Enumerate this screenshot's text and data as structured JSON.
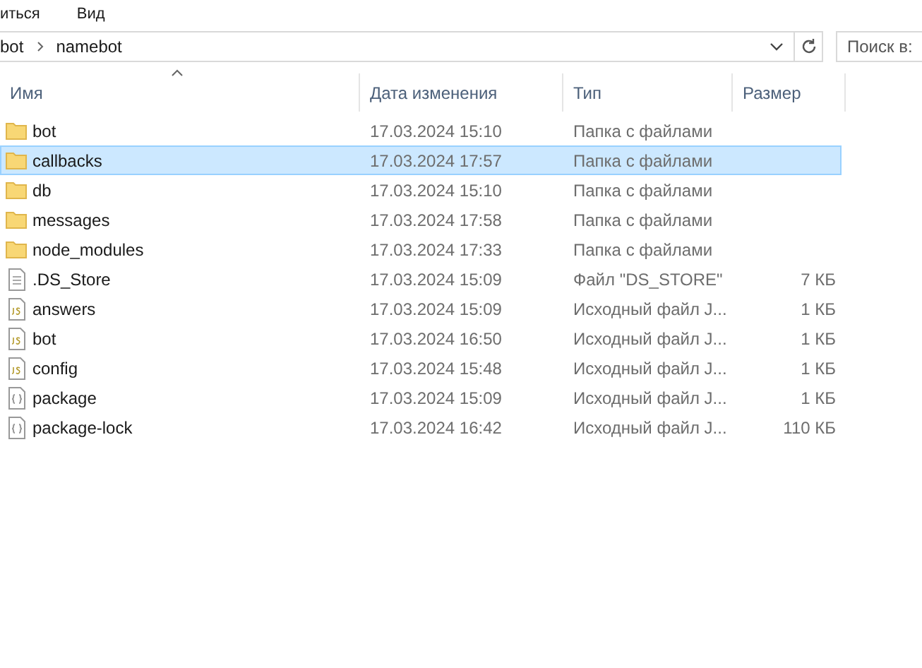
{
  "menu": [
    "иться",
    "Вид"
  ],
  "address": {
    "path": [
      "bot",
      "namebot"
    ]
  },
  "search": {
    "placeholder": "Поиск в:"
  },
  "table": {
    "columns": [
      "Имя",
      "Дата изменения",
      "Тип",
      "Размер"
    ],
    "rows": [
      {
        "kind": "folder",
        "name": "bot",
        "date": "17.03.2024 15:10",
        "type": "Папка с файлами",
        "selected": false
      },
      {
        "kind": "folder",
        "name": "callbacks",
        "date": "17.03.2024 17:57",
        "type": "Папка с файлами",
        "selected": true
      },
      {
        "kind": "folder",
        "name": "db",
        "date": "17.03.2024 15:10",
        "type": "Папка с файлами",
        "selected": false
      },
      {
        "kind": "folder",
        "name": "messages",
        "date": "17.03.2024 17:58",
        "type": "Папка с файлами",
        "selected": false
      },
      {
        "kind": "folder",
        "name": "node_modules",
        "date": "17.03.2024 17:33",
        "type": "Папка с файлами",
        "selected": false
      },
      {
        "kind": "text",
        "name": ".DS_Store",
        "date": "17.03.2024 15:09",
        "type": "Файл \"DS_STORE\"",
        "size": "7 КБ",
        "selected": false
      },
      {
        "kind": "js",
        "name": "answers",
        "date": "17.03.2024 15:09",
        "type": "Исходный файл J...",
        "size": "1 КБ",
        "selected": false
      },
      {
        "kind": "js",
        "name": "bot",
        "date": "17.03.2024 16:50",
        "type": "Исходный файл J...",
        "size": "1 КБ",
        "selected": false
      },
      {
        "kind": "js",
        "name": "config",
        "date": "17.03.2024 15:48",
        "type": "Исходный файл J...",
        "size": "1 КБ",
        "selected": false
      },
      {
        "kind": "json",
        "name": "package",
        "date": "17.03.2024 15:09",
        "type": "Исходный файл J...",
        "size": "1 КБ",
        "selected": false
      },
      {
        "kind": "json",
        "name": "package-lock",
        "date": "17.03.2024 16:42",
        "type": "Исходный файл J...",
        "size": "110 КБ",
        "selected": false
      }
    ]
  }
}
